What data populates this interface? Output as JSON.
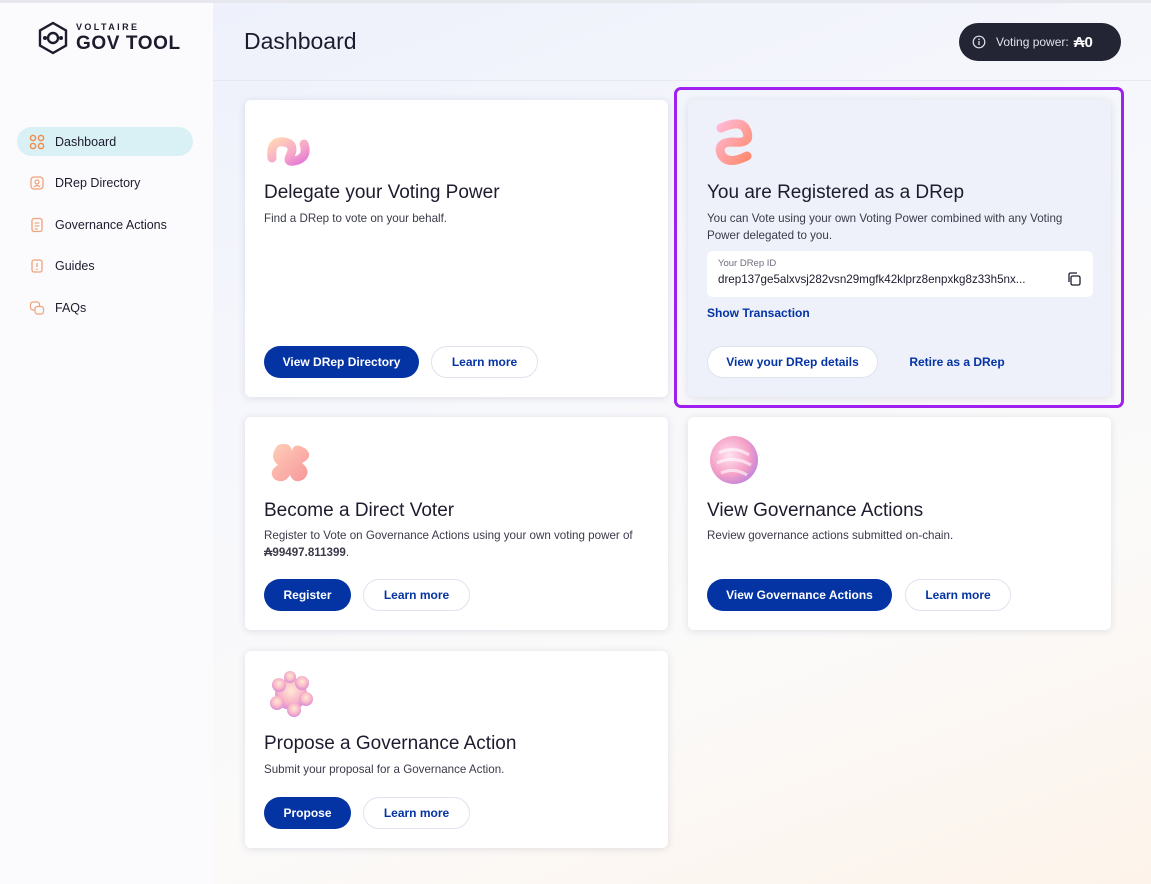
{
  "app": {
    "logo_top": "VOLTAIRE",
    "logo_bottom": "GOV TOOL"
  },
  "sidebar": {
    "items": [
      {
        "label": "Dashboard",
        "icon": "dashboard-grid-icon",
        "active": true
      },
      {
        "label": "DRep Directory",
        "icon": "drep-directory-icon",
        "active": false
      },
      {
        "label": "Governance Actions",
        "icon": "governance-actions-icon",
        "active": false
      },
      {
        "label": "Guides",
        "icon": "guides-icon",
        "active": false
      },
      {
        "label": "FAQs",
        "icon": "faqs-icon",
        "active": false
      }
    ]
  },
  "header": {
    "title": "Dashboard",
    "voting_power_label": "Voting power:",
    "voting_power_value": "₳0"
  },
  "cards": {
    "delegate": {
      "title": "Delegate your Voting Power",
      "description": "Find a DRep to vote on your behalf.",
      "primary_label": "View DRep Directory",
      "secondary_label": "Learn more"
    },
    "drep": {
      "title": "You are Registered as a DRep",
      "description": "You can Vote using your own Voting Power combined with any Voting Power delegated to you.",
      "id_label": "Your DRep ID",
      "id_value": "drep137ge5alxvsj282vsn29mgfk42klprz8enpxkg8z33h5nx...",
      "show_transaction": "Show Transaction",
      "details_label": "View your DRep details",
      "retire_label": "Retire as a DRep"
    },
    "direct_voter": {
      "title": "Become a Direct Voter",
      "description_prefix": "Register to Vote on Governance Actions using your own voting power of ",
      "amount": "₳99497.811399",
      "description_suffix": ".",
      "primary_label": "Register",
      "secondary_label": "Learn more"
    },
    "governance": {
      "title": "View Governance Actions",
      "description": "Review governance actions submitted on-chain.",
      "primary_label": "View Governance Actions",
      "secondary_label": "Learn more"
    },
    "propose": {
      "title": "Propose a Governance Action",
      "description": "Submit your proposal for a Governance Action.",
      "primary_label": "Propose",
      "secondary_label": "Learn more"
    }
  },
  "colors": {
    "primary": "#0433a4",
    "sidebar_active": "#d9f0f5",
    "highlight": "#a020f0",
    "pill": "#232535"
  }
}
